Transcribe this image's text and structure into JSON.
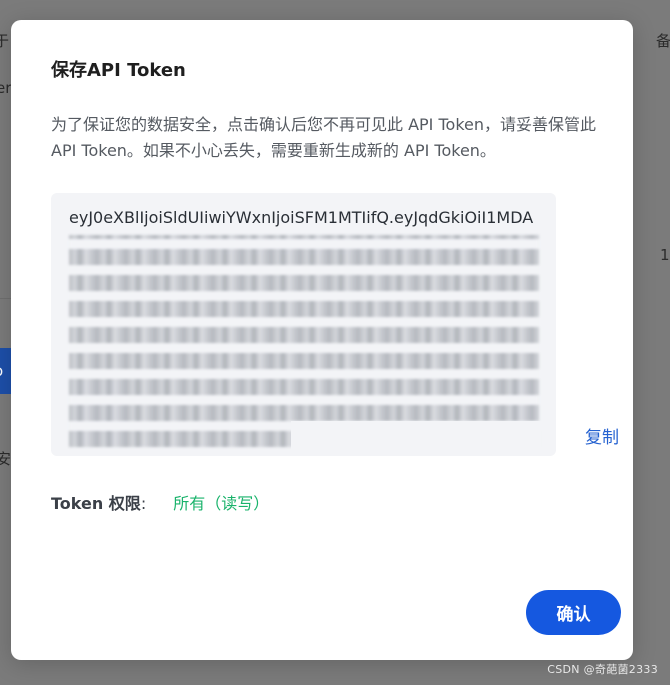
{
  "modal": {
    "title": "保存API Token",
    "description": "为了保证您的数据安全，点击确认后您不再可见此 API Token，请妥善保管此 API Token。如果不小心丢失，需要重新生成新的 API Token。",
    "token_visible": "eyJ0eXBlIjoiSldUIiwiYWxnIjoiSFM1MTIifQ.eyJqdGkiOiI1MDA",
    "copy_label": "复制",
    "permission_label": "Token 权限",
    "permission_colon": ":",
    "permission_value": "所有（读写）",
    "confirm_label": "确认"
  },
  "background": {
    "fragment_top_left": "于",
    "fragment_top_right": "备",
    "fragment_left_2": "er",
    "fragment_right_mid": "1",
    "fragment_button": "o",
    "fragment_left_bottom": "安"
  },
  "watermark": "CSDN @奇葩菌2333",
  "colors": {
    "overlay": "#7b7b7b",
    "primary": "#1558e0",
    "link": "#2461d0",
    "success": "#19b36b",
    "token_bg": "#f3f4f7"
  }
}
